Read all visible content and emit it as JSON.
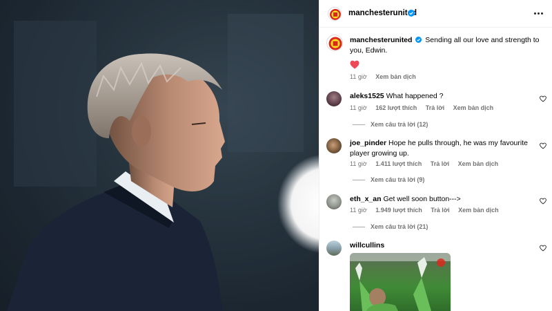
{
  "post": {
    "account": "manchesterunited",
    "caption": "Sending all our love and strength to you, Edwin.",
    "caption_emoji": "❤️",
    "caption_time": "11 giờ",
    "translate_label": "Xem bản dịch"
  },
  "comments": [
    {
      "user": "aleks1525",
      "text": "What happened ?",
      "time": "11 giờ",
      "likes": "162 lượt thích",
      "reply_label": "Trả lời",
      "translate_label": "Xem bản dịch",
      "view_replies": "Xem câu trả lời (12)"
    },
    {
      "user": "joe_pinder",
      "text": "Hope he pulls through, he was my favourite player growing up.",
      "time": "11 giờ",
      "likes": "1.411 lượt thích",
      "reply_label": "Trả lời",
      "translate_label": "Xem bản dịch",
      "view_replies": "Xem câu trả lời (9)"
    },
    {
      "user": "eth_x_an",
      "text": "Get well soon button--->",
      "time": "11 giờ",
      "likes": "1.949 lượt thích",
      "reply_label": "Trả lời",
      "translate_label": "Xem bản dịch",
      "view_replies": "Xem câu trả lời (21)"
    },
    {
      "user": "willcullins",
      "text": ""
    }
  ],
  "colors": {
    "verified": "#0095f6",
    "heart": "#ed4956",
    "meta_text": "#737373",
    "mu_red": "#da291c",
    "mu_yellow": "#fbe122"
  },
  "icons": [
    "verified-badge-icon",
    "more-options-icon",
    "heart-icon",
    "like-heart-icon"
  ]
}
